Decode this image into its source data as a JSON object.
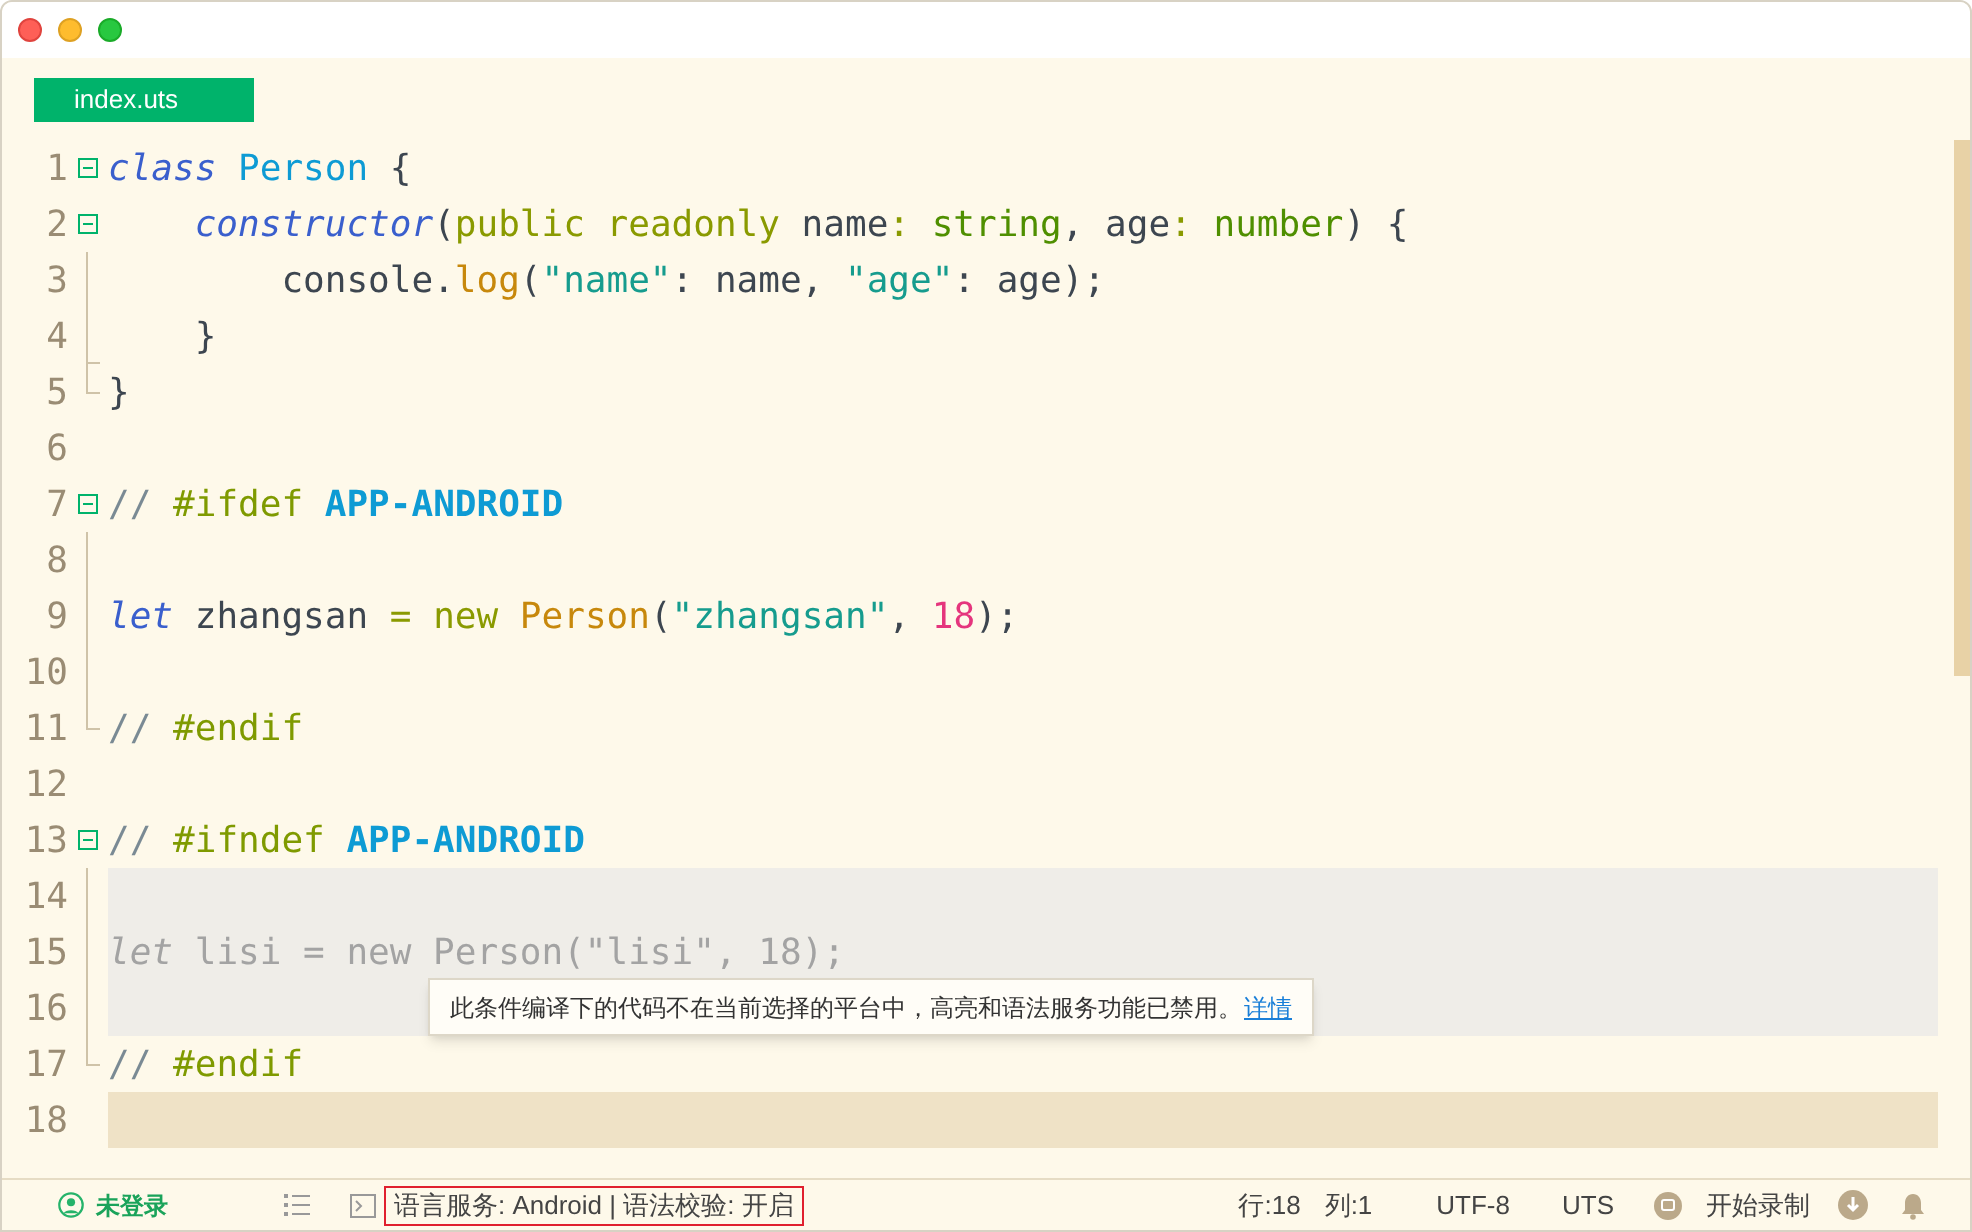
{
  "tabs": [
    {
      "label": "index.uts",
      "selected": true
    }
  ],
  "lines": [
    {
      "number": "1",
      "fold_toggle": true,
      "fold_guide": false,
      "fold_end": false,
      "disabled": false,
      "current": false,
      "tokens": [
        {
          "kind": "keyword",
          "text": "class"
        },
        {
          "kind": "type",
          "text": " Person"
        },
        {
          "kind": "plain",
          "text": " {"
        }
      ]
    },
    {
      "number": "2",
      "fold_toggle": true,
      "fold_guide": false,
      "fold_end": false,
      "disabled": false,
      "current": false,
      "tokens": [
        {
          "kind": "keyword",
          "text": "    constructor"
        },
        {
          "kind": "plain",
          "text": "("
        },
        {
          "kind": "modifier",
          "text": "public readonly"
        },
        {
          "kind": "plain",
          "text": " name"
        },
        {
          "kind": "modifier",
          "text": ":"
        },
        {
          "kind": "builtin",
          "text": " string"
        },
        {
          "kind": "plain",
          "text": ", age"
        },
        {
          "kind": "modifier",
          "text": ":"
        },
        {
          "kind": "builtin",
          "text": " number"
        },
        {
          "kind": "plain",
          "text": ") {"
        }
      ]
    },
    {
      "number": "3",
      "fold_toggle": false,
      "fold_guide": true,
      "fold_end": false,
      "disabled": false,
      "current": false,
      "tokens": [
        {
          "kind": "plain",
          "text": "        console."
        },
        {
          "kind": "function",
          "text": "log"
        },
        {
          "kind": "plain",
          "text": "("
        },
        {
          "kind": "string",
          "text": "\"name\""
        },
        {
          "kind": "plain",
          "text": ": name, "
        },
        {
          "kind": "string",
          "text": "\"age\""
        },
        {
          "kind": "plain",
          "text": ": age);"
        }
      ]
    },
    {
      "number": "4",
      "fold_toggle": false,
      "fold_guide": true,
      "fold_end": true,
      "disabled": false,
      "current": false,
      "tokens": [
        {
          "kind": "plain",
          "text": "    }"
        }
      ]
    },
    {
      "number": "5",
      "fold_toggle": false,
      "fold_guide": false,
      "fold_end": true,
      "disabled": false,
      "current": false,
      "tokens": [
        {
          "kind": "plain",
          "text": "}"
        }
      ]
    },
    {
      "number": "6",
      "fold_toggle": false,
      "fold_guide": false,
      "fold_end": false,
      "disabled": false,
      "current": false
    },
    {
      "number": "7",
      "fold_toggle": true,
      "fold_guide": false,
      "fold_end": false,
      "disabled": false,
      "current": false,
      "tokens": [
        {
          "kind": "comment",
          "text": "// "
        },
        {
          "kind": "directive",
          "text": "#ifdef"
        },
        {
          "kind": "macro",
          "text": " APP-ANDROID"
        }
      ]
    },
    {
      "number": "8",
      "fold_toggle": false,
      "fold_guide": true,
      "fold_end": false,
      "disabled": false,
      "current": false
    },
    {
      "number": "9",
      "fold_toggle": false,
      "fold_guide": true,
      "fold_end": false,
      "disabled": false,
      "current": false,
      "tokens": [
        {
          "kind": "keyword",
          "text": "let"
        },
        {
          "kind": "plain",
          "text": " zhangsan "
        },
        {
          "kind": "modifier",
          "text": "="
        },
        {
          "kind": "modifier",
          "text": " new"
        },
        {
          "kind": "function",
          "text": " Person"
        },
        {
          "kind": "plain",
          "text": "("
        },
        {
          "kind": "string",
          "text": "\"zhangsan\""
        },
        {
          "kind": "plain",
          "text": ", "
        },
        {
          "kind": "number",
          "text": "18"
        },
        {
          "kind": "plain",
          "text": ");"
        }
      ]
    },
    {
      "number": "10",
      "fold_toggle": false,
      "fold_guide": true,
      "fold_end": false,
      "disabled": false,
      "current": false
    },
    {
      "number": "11",
      "fold_toggle": false,
      "fold_guide": false,
      "fold_end": true,
      "disabled": false,
      "current": false,
      "tokens": [
        {
          "kind": "comment",
          "text": "// "
        },
        {
          "kind": "directive",
          "text": "#endif"
        }
      ]
    },
    {
      "number": "12",
      "fold_toggle": false,
      "fold_guide": false,
      "fold_end": false,
      "disabled": false,
      "current": false
    },
    {
      "number": "13",
      "fold_toggle": true,
      "fold_guide": false,
      "fold_end": false,
      "disabled": false,
      "current": false,
      "tokens": [
        {
          "kind": "comment",
          "text": "// "
        },
        {
          "kind": "directive",
          "text": "#ifndef"
        },
        {
          "kind": "macro",
          "text": " APP-ANDROID"
        }
      ]
    },
    {
      "number": "14",
      "fold_toggle": false,
      "fold_guide": true,
      "fold_end": false,
      "disabled": true,
      "current": false
    },
    {
      "number": "15",
      "fold_toggle": false,
      "fold_guide": true,
      "fold_end": false,
      "disabled": true,
      "current": false,
      "tokens": [
        {
          "kind": "keyword",
          "text": "let"
        },
        {
          "kind": "plain",
          "text": " lisi = new Person(\"lisi\", 18);"
        }
      ]
    },
    {
      "number": "16",
      "fold_toggle": false,
      "fold_guide": true,
      "fold_end": false,
      "disabled": true,
      "current": false
    },
    {
      "number": "17",
      "fold_toggle": false,
      "fold_guide": false,
      "fold_end": true,
      "disabled": false,
      "current": false,
      "tokens": [
        {
          "kind": "comment",
          "text": "// "
        },
        {
          "kind": "directive",
          "text": "#endif"
        }
      ]
    },
    {
      "number": "18",
      "fold_toggle": false,
      "fold_guide": false,
      "fold_end": false,
      "disabled": false,
      "current": true
    }
  ],
  "tooltip": {
    "text": "此条件编译下的代码不在当前选择的平台中，高亮和语法服务功能已禁用。",
    "link": "详情"
  },
  "status_bar": {
    "login": "未登录",
    "language_service": "语言服务: Android | 语法校验: 开启",
    "line": "行:18",
    "column": "列:1",
    "encoding": "UTF-8",
    "language": "UTS",
    "record": "开始录制"
  }
}
